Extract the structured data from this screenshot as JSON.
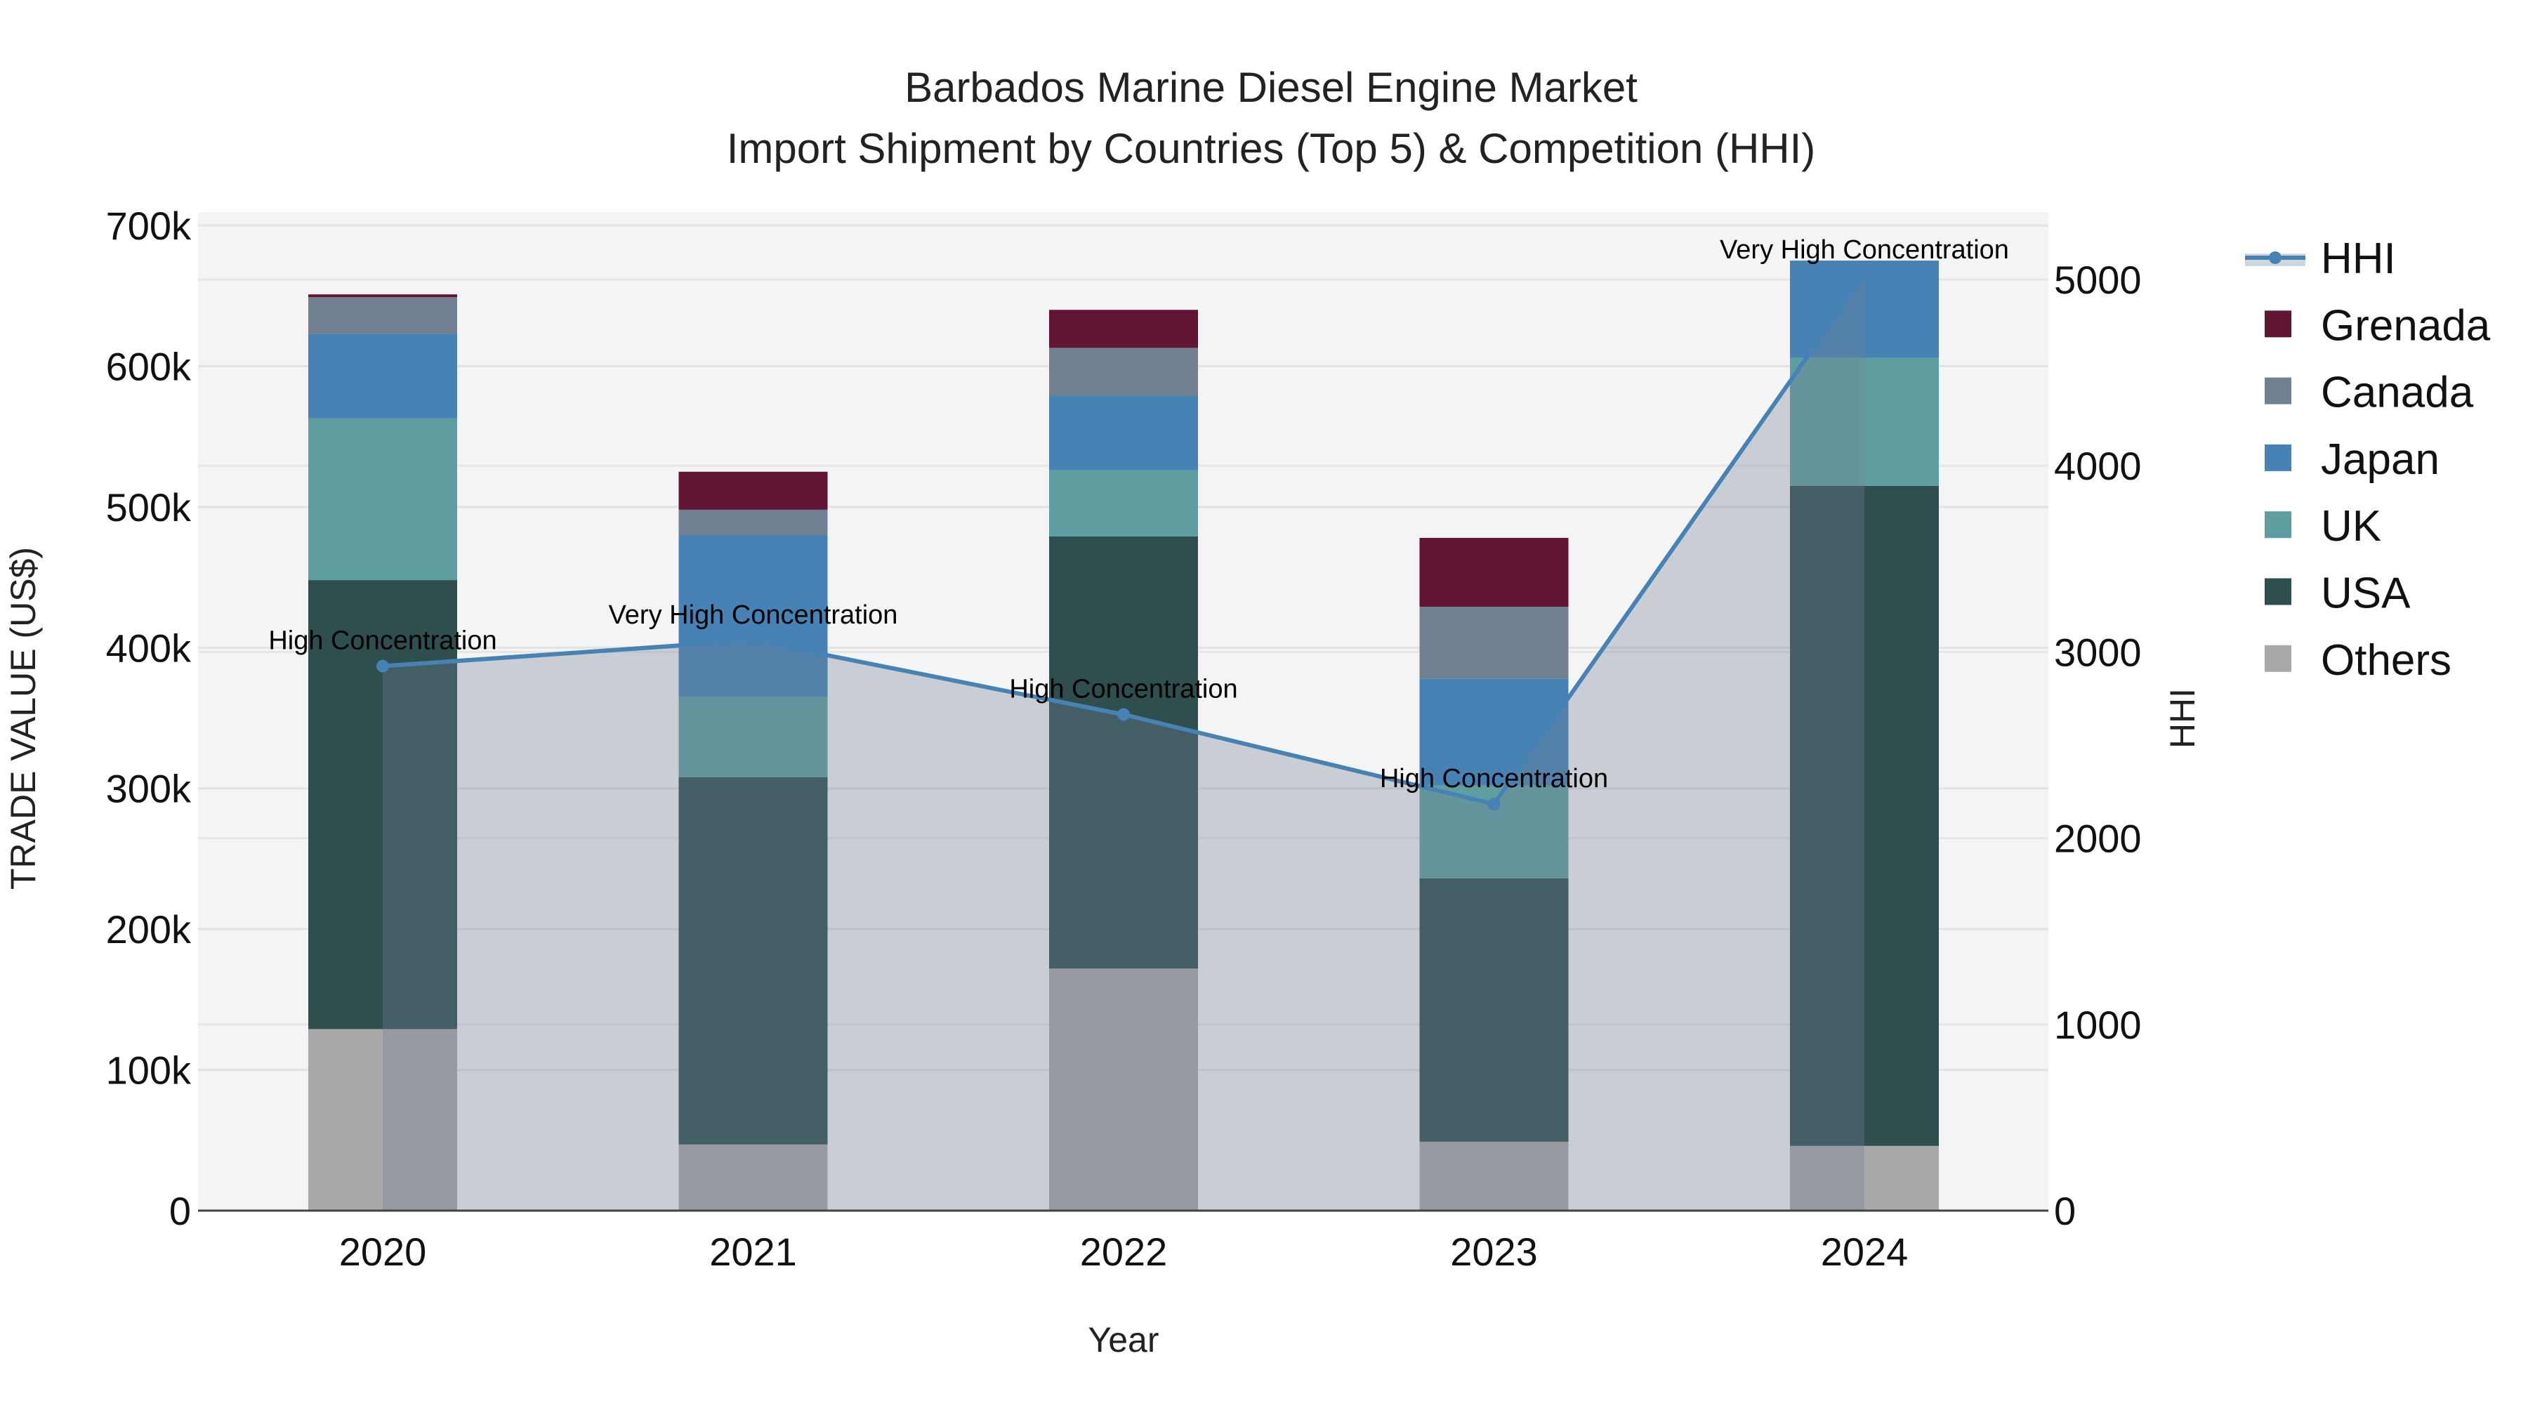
{
  "chart_data": {
    "type": "bar",
    "title": "Barbados Marine Diesel Engine Market",
    "subtitle": "Import Shipment by Countries (Top 5) & Competition (HHI)",
    "xlabel": "Year",
    "ylabel": "TRADE VALUE (US$)",
    "y2label": "HHI",
    "categories": [
      "2020",
      "2021",
      "2022",
      "2023",
      "2024"
    ],
    "ylim": [
      0,
      700000
    ],
    "y2lim": [
      0,
      5300
    ],
    "yticks": [
      "0",
      "100k",
      "200k",
      "300k",
      "400k",
      "500k",
      "600k",
      "700k"
    ],
    "y2ticks": [
      "0",
      "1000",
      "2000",
      "3000",
      "4000",
      "5000"
    ],
    "stacked": true,
    "grid": true,
    "legend_position": "right",
    "series": [
      {
        "name": "Others",
        "color": "#a9a9a9",
        "values": [
          129000,
          47000,
          172000,
          49000,
          46000
        ]
      },
      {
        "name": "USA",
        "color": "#2f4f4f",
        "values": [
          319000,
          261000,
          307000,
          187000,
          469000
        ]
      },
      {
        "name": "UK",
        "color": "#5f9ea0",
        "values": [
          115000,
          57000,
          47000,
          66000,
          91000
        ]
      },
      {
        "name": "Japan",
        "color": "#4682b4",
        "values": [
          60000,
          115000,
          53000,
          76000,
          69000
        ]
      },
      {
        "name": "Canada",
        "color": "#708090",
        "values": [
          26000,
          18000,
          34000,
          51000,
          0
        ]
      },
      {
        "name": "Grenada",
        "color": "#611434",
        "values": [
          2000,
          27000,
          27000,
          49000,
          0
        ]
      }
    ],
    "hhi": {
      "name": "HHI",
      "color": "#4682b4",
      "values": [
        2924,
        3062,
        2664,
        2183,
        5023
      ],
      "annotations": [
        "High Concentration",
        "Very High Concentration",
        "High Concentration",
        "High Concentration",
        "Very High Concentration"
      ]
    },
    "legend": [
      "HHI",
      "Grenada",
      "Canada",
      "Japan",
      "UK",
      "USA",
      "Others"
    ]
  }
}
